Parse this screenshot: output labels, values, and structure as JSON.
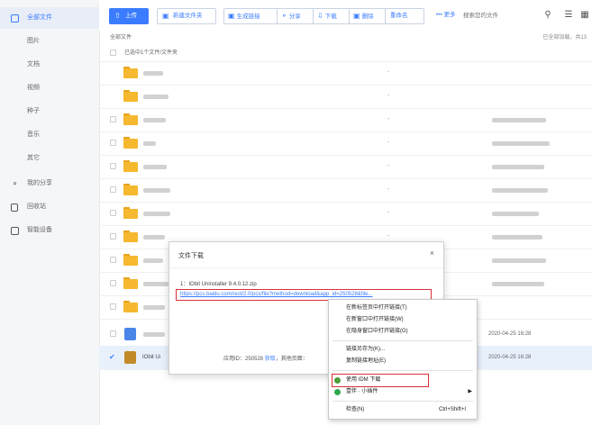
{
  "sidebar": {
    "items": [
      {
        "label": "全部文件",
        "icon": "files-icon"
      },
      {
        "label": "图片"
      },
      {
        "label": "文档"
      },
      {
        "label": "视频"
      },
      {
        "label": "种子"
      },
      {
        "label": "音乐"
      },
      {
        "label": "其它"
      },
      {
        "label": "我的分享",
        "icon": "share-icon"
      },
      {
        "label": "回收站",
        "icon": "trash-icon"
      },
      {
        "label": "智能设备",
        "icon": "device-icon"
      }
    ]
  },
  "toolbar": {
    "upload": "上传",
    "new_folder": "新建文件夹",
    "gen_link": "生成链接",
    "share": "分享",
    "download": "下载",
    "delete": "删除",
    "rename": "重命名",
    "more": "••• 更多",
    "search_placeholder": "搜索您的文件"
  },
  "breadcrumb": "全部文件",
  "loaded_status": "已全部加载，共13",
  "select_header": "已选中1个文件/文件夹",
  "rows": {
    "r11": {
      "date": "2020-04-25 16:28"
    },
    "r12": {
      "name": "IObit Ui",
      "date": "2020-04-25 16:28"
    }
  },
  "dialog": {
    "title": "文件下载",
    "close": "×",
    "file_line": "1：IObit Uninstaller 9.4.0.12.zip",
    "link": "https://pcs.baidu.com/rest/2.0/pcs/file?method=download&app_id=250528&file...",
    "appid_prefix": "应用ID：250528",
    "appid_link": "获取",
    "appid_suffix": "，其他页面："
  },
  "context_menu": {
    "items": [
      {
        "label": "在新标签页中打开链接(T)"
      },
      {
        "label": "在新窗口中打开链接(W)"
      },
      {
        "label": "在隐身窗口中打开链接(G)"
      },
      {
        "label": "链接另存为(K)..."
      },
      {
        "label": "复制链接地址(E)"
      },
      {
        "label": "使用 IDM 下载"
      },
      {
        "label": "壹伴 · 小插件"
      },
      {
        "label": "检查(N)",
        "shortcut": "Ctrl+Shift+I"
      }
    ]
  },
  "colors": {
    "accent": "#3b7cff",
    "highlight": "#d9303b",
    "folder": "#f5b82e"
  }
}
